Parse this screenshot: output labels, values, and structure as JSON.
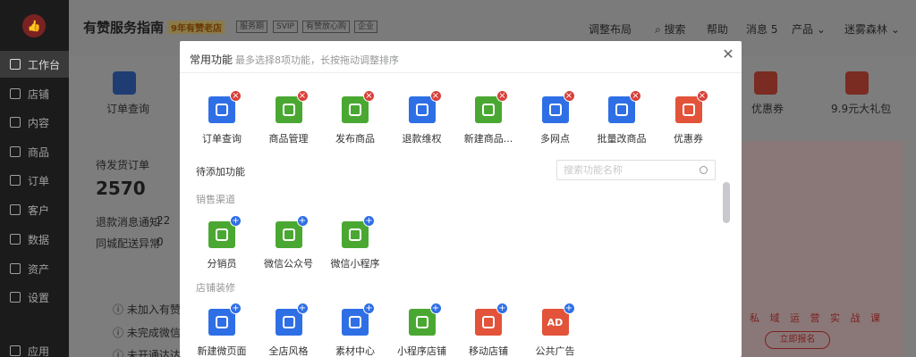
{
  "sidebar": {
    "logo": "👍",
    "items": [
      {
        "label": "工作台"
      },
      {
        "label": "店铺"
      },
      {
        "label": "内容"
      },
      {
        "label": "商品"
      },
      {
        "label": "订单"
      },
      {
        "label": "客户"
      },
      {
        "label": "数据"
      },
      {
        "label": "资产"
      },
      {
        "label": "设置"
      },
      {
        "label": "应用"
      }
    ]
  },
  "header": {
    "title": "有赞服务指南",
    "year_badge": "9年有赞老店",
    "tags": [
      "服务期",
      "SVIP",
      "有赞放心购",
      "企业"
    ],
    "nav": [
      "调整布局",
      "搜索",
      "帮助",
      "消息 5",
      "产品",
      "迷雾森林"
    ]
  },
  "background": {
    "quick_left": "订单查询",
    "quick_right": [
      "优惠券",
      "9.9元大礼包"
    ],
    "pending_title": "待发货订单",
    "pending_count": "2570",
    "refund_label": "退款消息通知",
    "refund_count": "22",
    "city_label": "同城配送异常",
    "city_count": "0",
    "notices": [
      "未加入有赞放",
      "未完成微信支",
      "未开通达达快"
    ],
    "promo_text": "私 域 运 营 实 战 课",
    "promo_btn": "立即报名"
  },
  "modal": {
    "title": "常用功能",
    "hint": "最多选择8项功能，长按拖动调整排序",
    "close": "✕",
    "common": [
      {
        "label": "订单查询",
        "color": "#2f6fe6",
        "icon": "order-icon"
      },
      {
        "label": "商品管理",
        "color": "#4aa832",
        "icon": "goods-icon"
      },
      {
        "label": "发布商品",
        "color": "#4aa832",
        "icon": "publish-icon"
      },
      {
        "label": "退款维权",
        "color": "#2f6fe6",
        "icon": "refund-icon"
      },
      {
        "label": "新建商品...",
        "color": "#4aa832",
        "icon": "new-goods-icon"
      },
      {
        "label": "多网点",
        "color": "#2f6fe6",
        "icon": "location-icon"
      },
      {
        "label": "批量改商品",
        "color": "#2f6fe6",
        "icon": "bag-icon"
      },
      {
        "label": "优惠券",
        "color": "#e2533a",
        "icon": "coupon-icon"
      }
    ],
    "pending_title": "待添加功能",
    "search_placeholder": "搜索功能名称",
    "groups": [
      {
        "title": "销售渠道",
        "items": [
          {
            "label": "分销员",
            "color": "#4aa832",
            "icon": "person-icon"
          },
          {
            "label": "微信公众号",
            "color": "#4aa832",
            "icon": "wechat-icon"
          },
          {
            "label": "微信小程序",
            "color": "#4aa832",
            "icon": "miniprogram-icon"
          }
        ]
      },
      {
        "title": "店铺装修",
        "items": [
          {
            "label": "新建微页面",
            "color": "#2f6fe6",
            "icon": "page-icon"
          },
          {
            "label": "全店风格",
            "color": "#2f6fe6",
            "icon": "brush-icon"
          },
          {
            "label": "素材中心",
            "color": "#2f6fe6",
            "icon": "image-icon"
          },
          {
            "label": "小程序店铺",
            "color": "#4aa832",
            "icon": "store-icon"
          },
          {
            "label": "移动店铺",
            "color": "#e2533a",
            "icon": "mobile-store-icon"
          },
          {
            "label": "公共广告",
            "color": "#e2533a",
            "icon": "ad-icon"
          }
        ]
      }
    ],
    "ad_glyph": "AD",
    "badge_del": "×",
    "badge_add": "+"
  }
}
